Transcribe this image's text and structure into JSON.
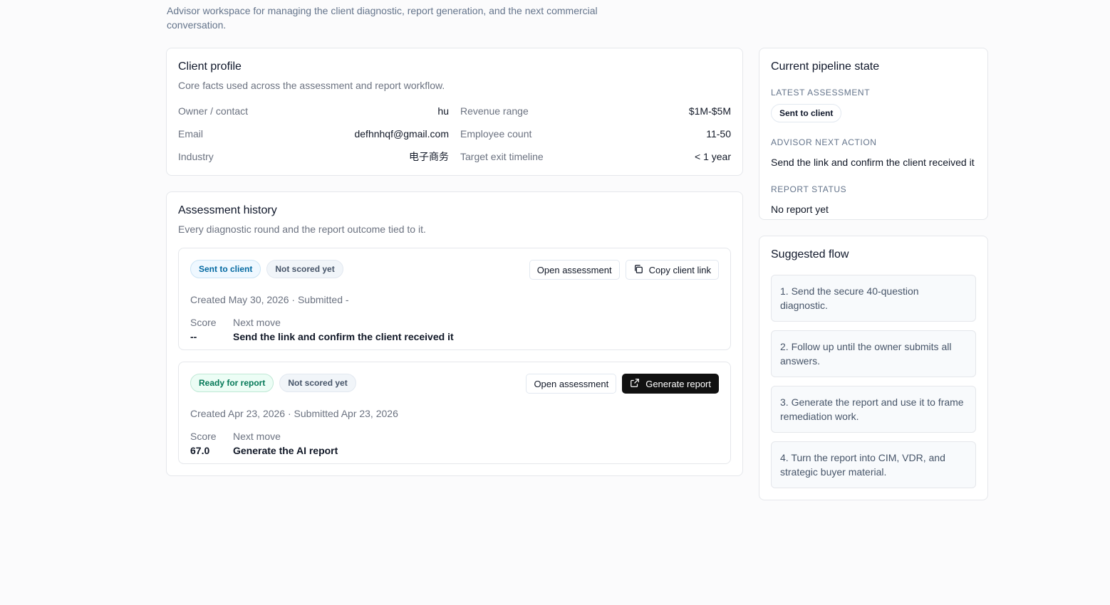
{
  "page": {
    "description": "Advisor workspace for managing the client diagnostic, report generation, and the next commercial conversation."
  },
  "client_profile": {
    "title": "Client profile",
    "subtitle": "Core facts used across the assessment and report workflow.",
    "fields": [
      {
        "label": "Owner / contact",
        "value": "hu"
      },
      {
        "label": "Revenue range",
        "value": "$1M-$5M"
      },
      {
        "label": "Email",
        "value": "defhnhqf@gmail.com"
      },
      {
        "label": "Employee count",
        "value": "11-50"
      },
      {
        "label": "Industry",
        "value": "电子商务"
      },
      {
        "label": "Target exit timeline",
        "value": "< 1 year"
      }
    ]
  },
  "assessment_history": {
    "title": "Assessment history",
    "subtitle": "Every diagnostic round and the report outcome tied to it.",
    "items": [
      {
        "status_badge": "Sent to client",
        "score_badge": "Not scored yet",
        "open_label": "Open assessment",
        "secondary_label": "Copy client link",
        "secondary_icon": "copy-icon",
        "meta": "Created May 30, 2026 · Submitted -",
        "score_label": "Score",
        "score_value": "--",
        "move_label": "Next move",
        "move_value": "Send the link and confirm the client received it"
      },
      {
        "status_badge": "Ready for report",
        "score_badge": "Not scored yet",
        "open_label": "Open assessment",
        "secondary_label": "Generate report",
        "secondary_icon": "external-link-icon",
        "meta": "Created Apr 23, 2026 · Submitted Apr 23, 2026",
        "score_label": "Score",
        "score_value": "67.0",
        "move_label": "Next move",
        "move_value": "Generate the AI report"
      }
    ]
  },
  "pipeline_state": {
    "title": "Current pipeline state",
    "latest_assessment_label": "LATEST ASSESSMENT",
    "latest_assessment_value": "Sent to client",
    "next_action_label": "ADVISOR NEXT ACTION",
    "next_action_value": "Send the link and confirm the client received it",
    "report_status_label": "REPORT STATUS",
    "report_status_value": "No report yet"
  },
  "suggested_flow": {
    "title": "Suggested flow",
    "steps": [
      "1. Send the secure 40-question diagnostic.",
      "2. Follow up until the owner submits all answers.",
      "3. Generate the report and use it to frame remediation work.",
      "4. Turn the report into CIM, VDR, and strategic buyer material."
    ]
  },
  "colors": {
    "sent_badge": "#0369a1",
    "ready_badge": "#047857",
    "primary_button": "#111111"
  }
}
